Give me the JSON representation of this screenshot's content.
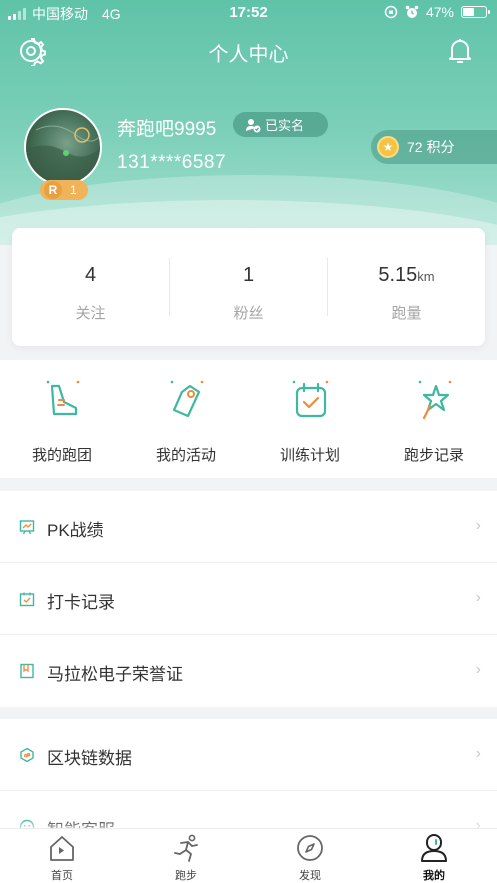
{
  "status_bar": {
    "carrier": "中国移动",
    "network": "4G",
    "time": "17:52",
    "battery": "47%"
  },
  "header": {
    "title": "个人中心"
  },
  "profile": {
    "name": "奔跑吧9995",
    "verified_label": "已实名",
    "phone": "131****6587",
    "rank_letter": "R",
    "rank_level": "1",
    "points_label": "72 积分"
  },
  "stats": [
    {
      "value": "4",
      "unit": "",
      "label": "关注"
    },
    {
      "value": "1",
      "unit": "",
      "label": "粉丝"
    },
    {
      "value": "5.15",
      "unit": "km",
      "label": "跑量"
    }
  ],
  "quick_actions": [
    {
      "label": "我的跑团",
      "icon": "running-shoe-icon"
    },
    {
      "label": "我的活动",
      "icon": "tag-icon"
    },
    {
      "label": "训练计划",
      "icon": "calendar-check-icon"
    },
    {
      "label": "跑步记录",
      "icon": "star-wand-icon"
    }
  ],
  "menu_group_1": [
    {
      "label": "PK战绩",
      "icon": "chart-board-icon"
    },
    {
      "label": "打卡记录",
      "icon": "calendar-check-icon"
    },
    {
      "label": "马拉松电子荣誉证",
      "icon": "certificate-icon"
    }
  ],
  "menu_group_2": [
    {
      "label": "区块链数据",
      "icon": "blockchain-cube-icon"
    },
    {
      "label": "智能客服",
      "icon": "smiley-service-icon"
    }
  ],
  "tabs": [
    {
      "label": "首页",
      "icon": "home-icon"
    },
    {
      "label": "跑步",
      "icon": "runner-icon"
    },
    {
      "label": "发现",
      "icon": "compass-icon"
    },
    {
      "label": "我的",
      "icon": "profile-icon",
      "active": true
    }
  ],
  "colors": {
    "accent": "#5fc3a8",
    "icon_green": "#3fb8a0",
    "icon_orange": "#f08a3c"
  }
}
